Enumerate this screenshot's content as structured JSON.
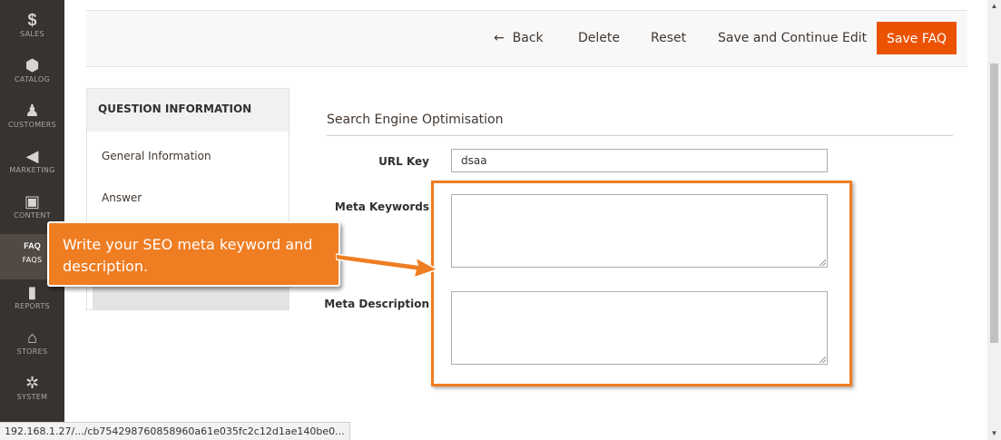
{
  "nav": {
    "items": [
      {
        "icon": "$",
        "label": "SALES"
      },
      {
        "icon": "⬢",
        "label": "CATALOG"
      },
      {
        "icon": "♟",
        "label": "CUSTOMERS"
      },
      {
        "icon": "◀",
        "label": "MARKETING"
      },
      {
        "icon": "▣",
        "label": "CONTENT"
      },
      {
        "icon": "FAQ",
        "label": "FAQS"
      },
      {
        "icon": "▮",
        "label": "REPORTS"
      },
      {
        "icon": "⌂",
        "label": "STORES"
      },
      {
        "icon": "✲",
        "label": "SYSTEM"
      }
    ],
    "active_label": "FAQS"
  },
  "actions": {
    "back_icon": "←",
    "back": "Back",
    "delete": "Delete",
    "reset": "Reset",
    "save_continue": "Save and Continue Edit",
    "save": "Save FAQ"
  },
  "tabs": {
    "title": "QUESTION INFORMATION",
    "items": [
      "General Information",
      "Answer"
    ]
  },
  "section": {
    "title": "Search Engine Optimisation",
    "url_key_label": "URL Key",
    "url_key_value": "dsaa",
    "meta_keywords_label": "Meta Keywords",
    "meta_description_label": "Meta Description"
  },
  "callout": {
    "text": "Write your SEO meta keyword and description."
  },
  "status_url": "192.168.1.27/.../cb754298760858960a61e035fc2c12d1ae140be0...",
  "colors": {
    "accent": "#eb5202",
    "callout": "#ef7d22",
    "nav_bg": "#373330"
  }
}
